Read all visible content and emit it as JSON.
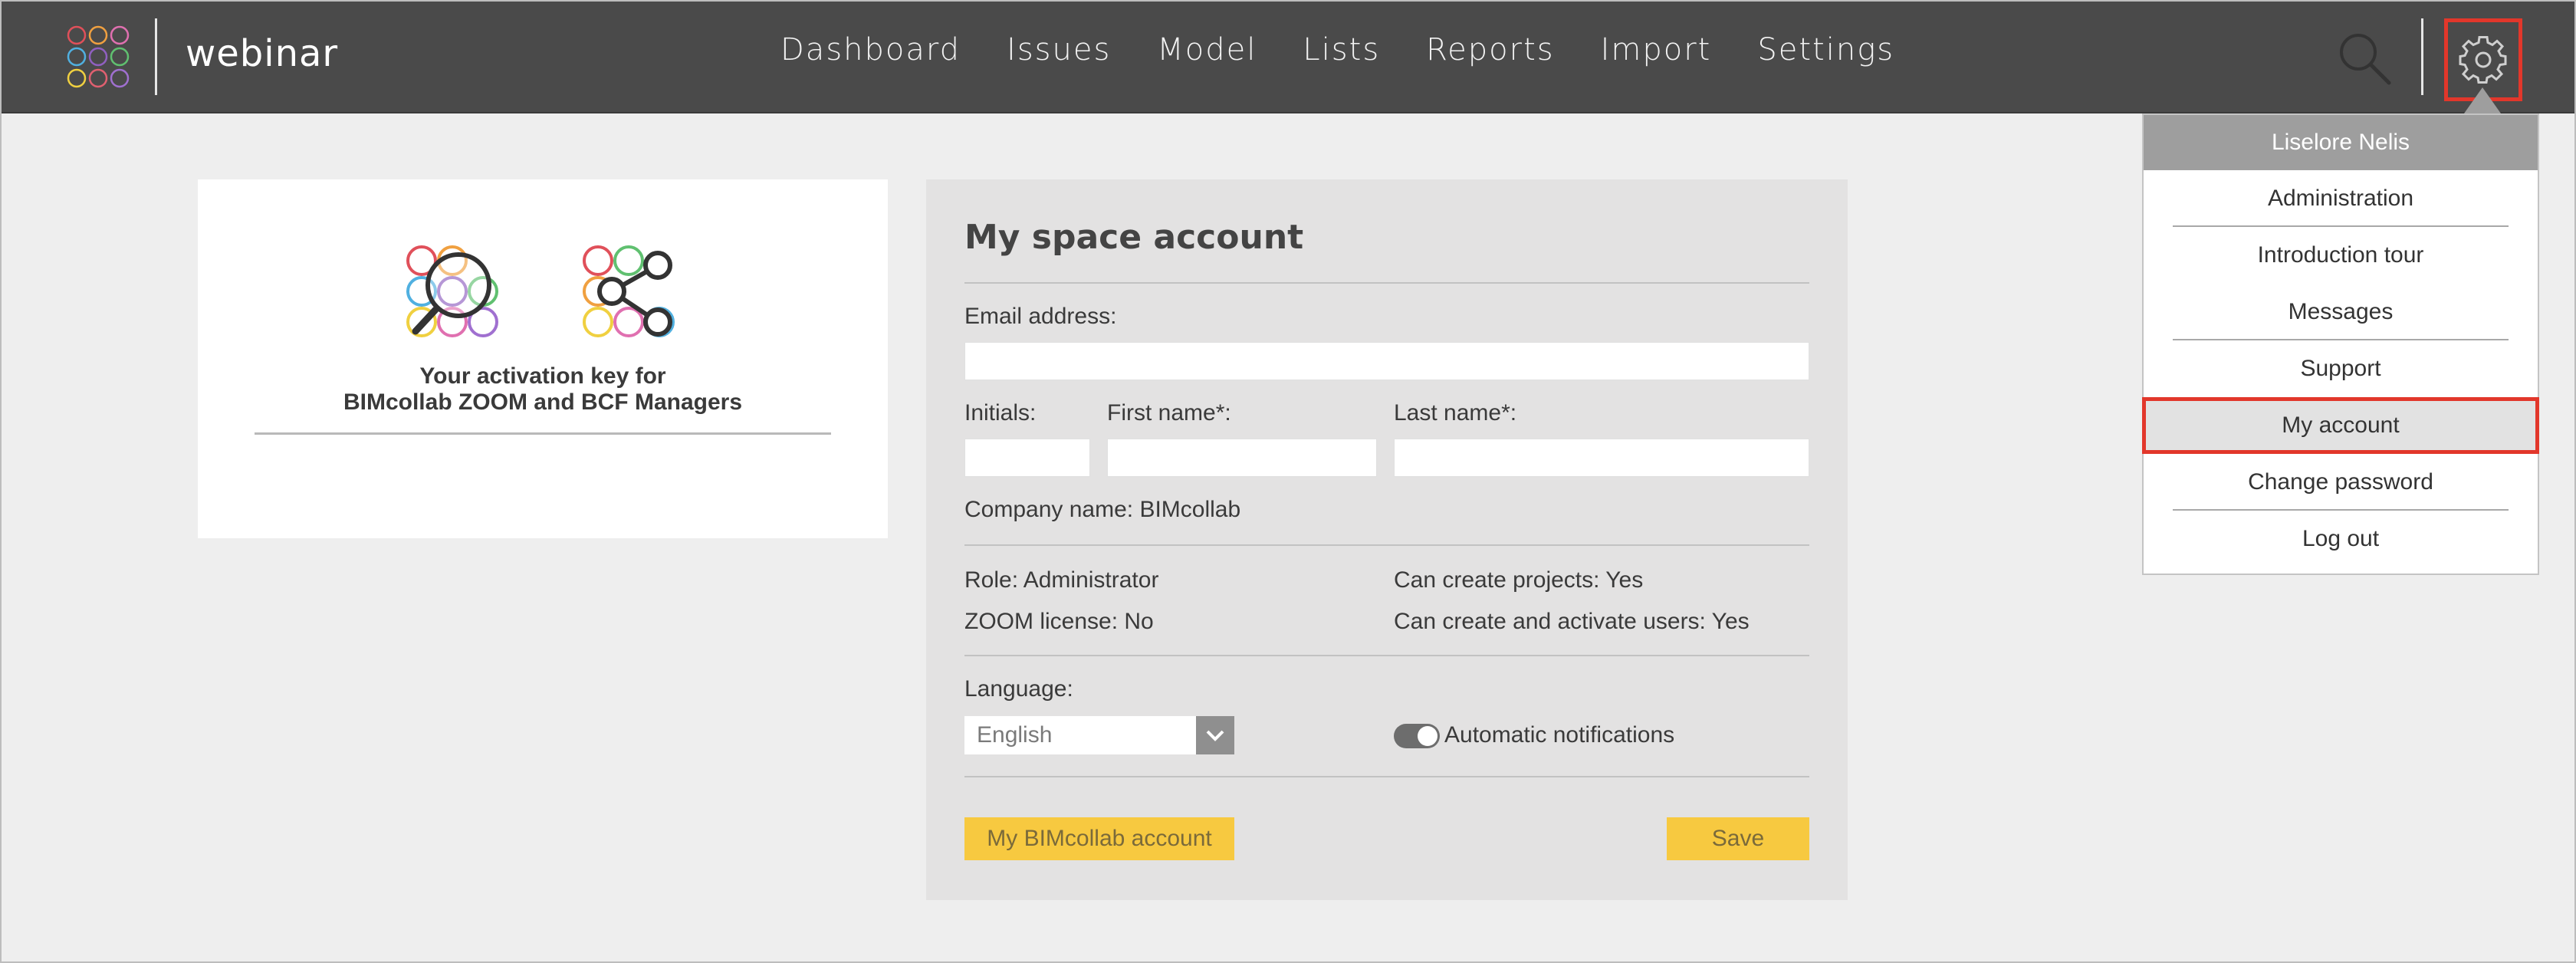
{
  "header": {
    "project_name": "webinar",
    "nav": [
      "Dashboard",
      "Issues",
      "Model",
      "Lists",
      "Reports",
      "Import",
      "Settings"
    ]
  },
  "user_menu": {
    "user_name": "Liselore Nelis",
    "items": [
      "Administration",
      "Introduction tour",
      "Messages",
      "Support",
      "My account",
      "Change password",
      "Log out"
    ],
    "active_item": "My account"
  },
  "activation_card": {
    "title_line1": "Your activation key for",
    "title_line2": "BIMcollab ZOOM and BCF Managers"
  },
  "account_panel": {
    "title": "My space account",
    "email_label": "Email address:",
    "initials_label": "Initials:",
    "first_name_label": "First name*:",
    "last_name_label": "Last name*:",
    "company": "Company name: BIMcollab",
    "role": "Role: Administrator",
    "zoom_license": "ZOOM license: No",
    "can_create_projects": "Can create projects: Yes",
    "can_create_users": "Can create and activate users: Yes",
    "language_label": "Language:",
    "language_value": "English",
    "notifications_label": "Automatic notifications",
    "notifications_enabled": true,
    "bimcollab_button": "My BIMcollab account",
    "save_button": "Save"
  },
  "colors": {
    "topbar": "#4a4a4a",
    "highlight": "#e2372b",
    "button": "#f7c940"
  }
}
